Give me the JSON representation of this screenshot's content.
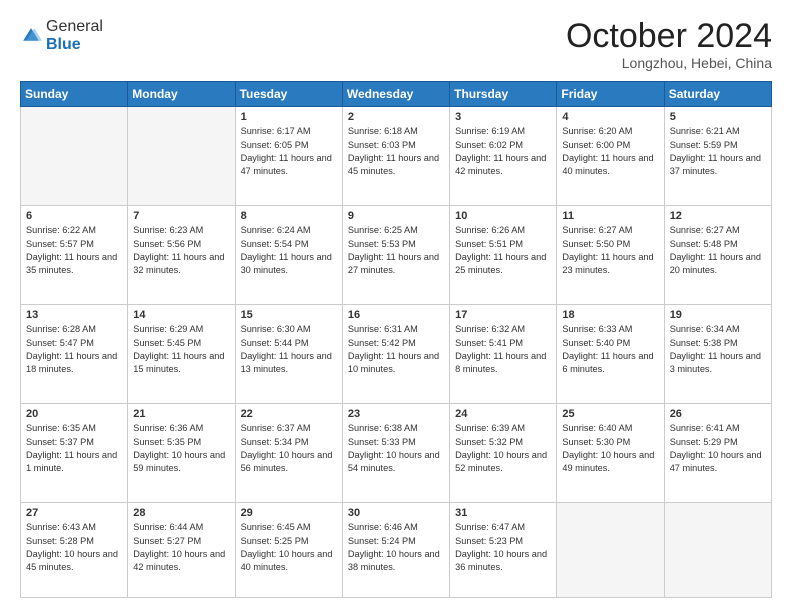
{
  "header": {
    "logo_general": "General",
    "logo_blue": "Blue",
    "month": "October 2024",
    "location": "Longzhou, Hebei, China"
  },
  "days_of_week": [
    "Sunday",
    "Monday",
    "Tuesday",
    "Wednesday",
    "Thursday",
    "Friday",
    "Saturday"
  ],
  "weeks": [
    [
      {
        "day": "",
        "info": ""
      },
      {
        "day": "",
        "info": ""
      },
      {
        "day": "1",
        "info": "Sunrise: 6:17 AM\nSunset: 6:05 PM\nDaylight: 11 hours and 47 minutes."
      },
      {
        "day": "2",
        "info": "Sunrise: 6:18 AM\nSunset: 6:03 PM\nDaylight: 11 hours and 45 minutes."
      },
      {
        "day": "3",
        "info": "Sunrise: 6:19 AM\nSunset: 6:02 PM\nDaylight: 11 hours and 42 minutes."
      },
      {
        "day": "4",
        "info": "Sunrise: 6:20 AM\nSunset: 6:00 PM\nDaylight: 11 hours and 40 minutes."
      },
      {
        "day": "5",
        "info": "Sunrise: 6:21 AM\nSunset: 5:59 PM\nDaylight: 11 hours and 37 minutes."
      }
    ],
    [
      {
        "day": "6",
        "info": "Sunrise: 6:22 AM\nSunset: 5:57 PM\nDaylight: 11 hours and 35 minutes."
      },
      {
        "day": "7",
        "info": "Sunrise: 6:23 AM\nSunset: 5:56 PM\nDaylight: 11 hours and 32 minutes."
      },
      {
        "day": "8",
        "info": "Sunrise: 6:24 AM\nSunset: 5:54 PM\nDaylight: 11 hours and 30 minutes."
      },
      {
        "day": "9",
        "info": "Sunrise: 6:25 AM\nSunset: 5:53 PM\nDaylight: 11 hours and 27 minutes."
      },
      {
        "day": "10",
        "info": "Sunrise: 6:26 AM\nSunset: 5:51 PM\nDaylight: 11 hours and 25 minutes."
      },
      {
        "day": "11",
        "info": "Sunrise: 6:27 AM\nSunset: 5:50 PM\nDaylight: 11 hours and 23 minutes."
      },
      {
        "day": "12",
        "info": "Sunrise: 6:27 AM\nSunset: 5:48 PM\nDaylight: 11 hours and 20 minutes."
      }
    ],
    [
      {
        "day": "13",
        "info": "Sunrise: 6:28 AM\nSunset: 5:47 PM\nDaylight: 11 hours and 18 minutes."
      },
      {
        "day": "14",
        "info": "Sunrise: 6:29 AM\nSunset: 5:45 PM\nDaylight: 11 hours and 15 minutes."
      },
      {
        "day": "15",
        "info": "Sunrise: 6:30 AM\nSunset: 5:44 PM\nDaylight: 11 hours and 13 minutes."
      },
      {
        "day": "16",
        "info": "Sunrise: 6:31 AM\nSunset: 5:42 PM\nDaylight: 11 hours and 10 minutes."
      },
      {
        "day": "17",
        "info": "Sunrise: 6:32 AM\nSunset: 5:41 PM\nDaylight: 11 hours and 8 minutes."
      },
      {
        "day": "18",
        "info": "Sunrise: 6:33 AM\nSunset: 5:40 PM\nDaylight: 11 hours and 6 minutes."
      },
      {
        "day": "19",
        "info": "Sunrise: 6:34 AM\nSunset: 5:38 PM\nDaylight: 11 hours and 3 minutes."
      }
    ],
    [
      {
        "day": "20",
        "info": "Sunrise: 6:35 AM\nSunset: 5:37 PM\nDaylight: 11 hours and 1 minute."
      },
      {
        "day": "21",
        "info": "Sunrise: 6:36 AM\nSunset: 5:35 PM\nDaylight: 10 hours and 59 minutes."
      },
      {
        "day": "22",
        "info": "Sunrise: 6:37 AM\nSunset: 5:34 PM\nDaylight: 10 hours and 56 minutes."
      },
      {
        "day": "23",
        "info": "Sunrise: 6:38 AM\nSunset: 5:33 PM\nDaylight: 10 hours and 54 minutes."
      },
      {
        "day": "24",
        "info": "Sunrise: 6:39 AM\nSunset: 5:32 PM\nDaylight: 10 hours and 52 minutes."
      },
      {
        "day": "25",
        "info": "Sunrise: 6:40 AM\nSunset: 5:30 PM\nDaylight: 10 hours and 49 minutes."
      },
      {
        "day": "26",
        "info": "Sunrise: 6:41 AM\nSunset: 5:29 PM\nDaylight: 10 hours and 47 minutes."
      }
    ],
    [
      {
        "day": "27",
        "info": "Sunrise: 6:43 AM\nSunset: 5:28 PM\nDaylight: 10 hours and 45 minutes."
      },
      {
        "day": "28",
        "info": "Sunrise: 6:44 AM\nSunset: 5:27 PM\nDaylight: 10 hours and 42 minutes."
      },
      {
        "day": "29",
        "info": "Sunrise: 6:45 AM\nSunset: 5:25 PM\nDaylight: 10 hours and 40 minutes."
      },
      {
        "day": "30",
        "info": "Sunrise: 6:46 AM\nSunset: 5:24 PM\nDaylight: 10 hours and 38 minutes."
      },
      {
        "day": "31",
        "info": "Sunrise: 6:47 AM\nSunset: 5:23 PM\nDaylight: 10 hours and 36 minutes."
      },
      {
        "day": "",
        "info": ""
      },
      {
        "day": "",
        "info": ""
      }
    ]
  ]
}
